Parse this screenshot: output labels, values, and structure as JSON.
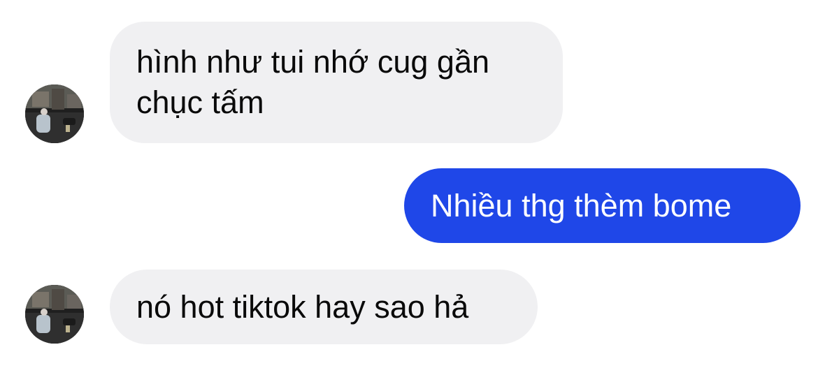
{
  "messages": [
    {
      "direction": "incoming",
      "text": "hình như tui nhớ cug gần chục tấm"
    },
    {
      "direction": "outgoing",
      "text": "Nhiều thg thèm bome"
    },
    {
      "direction": "incoming",
      "text": "nó hot tiktok hay sao hả"
    }
  ],
  "colors": {
    "incoming_bubble": "#f0f0f2",
    "outgoing_bubble": "#1f47e8",
    "incoming_text": "#0a0a0a",
    "outgoing_text": "#ffffff"
  },
  "icons": {
    "avatar": "contact-avatar-icon"
  }
}
